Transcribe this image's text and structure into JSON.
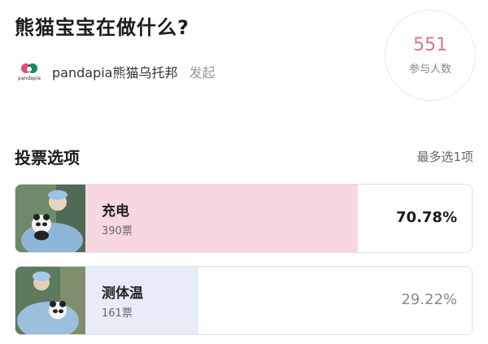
{
  "poll": {
    "title": "熊猫宝宝在做什么?",
    "author": "pandapia熊猫乌托邦",
    "author_action": "发起",
    "logo_text": "pandapia",
    "participants": "551",
    "participants_label": "参与人数"
  },
  "section": {
    "title": "投票选项",
    "note": "最多选1项"
  },
  "options": [
    {
      "label": "充电",
      "votes": "390票",
      "percent": "70.78%",
      "fill_fraction": 0.7078,
      "fill_color": "#f7d7e2"
    },
    {
      "label": "测体温",
      "votes": "161票",
      "percent": "29.22%",
      "fill_fraction": 0.2922,
      "fill_color": "#e8ecf8"
    }
  ],
  "colors": {
    "accent": "#d4788f",
    "winner_fill": "#f7d7e2",
    "other_fill": "#e8ecf8"
  }
}
